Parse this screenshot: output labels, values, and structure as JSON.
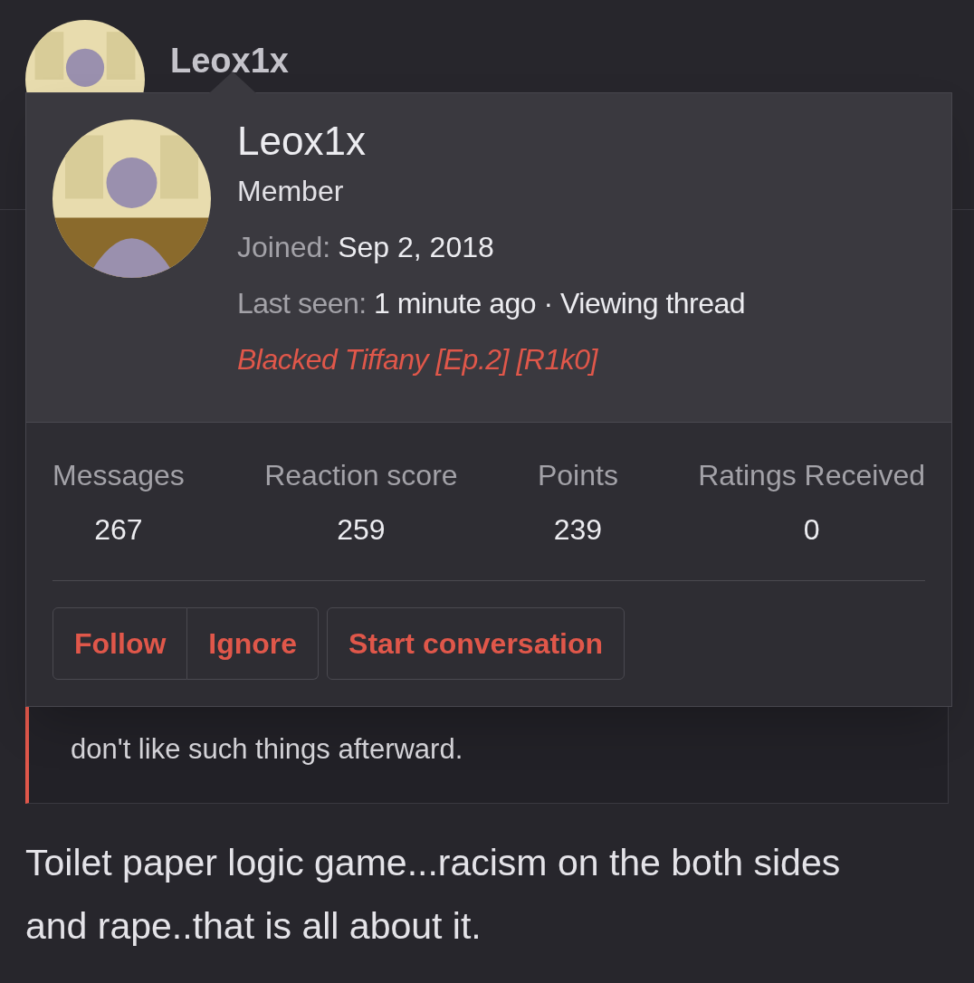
{
  "user_header": {
    "username": "Leox1x"
  },
  "popup": {
    "username": "Leox1x",
    "title": "Member",
    "joined_label": "Joined:",
    "joined": "Sep 2, 2018",
    "last_seen_label": "Last seen:",
    "last_seen": "1 minute ago · Viewing thread",
    "thread_link": "Blacked Tiffany [Ep.2] [R1k0]",
    "stats": [
      {
        "label": "Messages",
        "value": "267"
      },
      {
        "label": "Reaction score",
        "value": "259"
      },
      {
        "label": "Points",
        "value": "239"
      },
      {
        "label": "Ratings Received",
        "value": "0"
      }
    ],
    "button_groups": [
      [
        "Follow",
        "Ignore"
      ],
      [
        "Start conversation"
      ]
    ]
  },
  "quote": {
    "text": "don't like such things afterward."
  },
  "post": {
    "text": "Toilet paper logic game...racism on the both sides and rape..that is all about it."
  }
}
